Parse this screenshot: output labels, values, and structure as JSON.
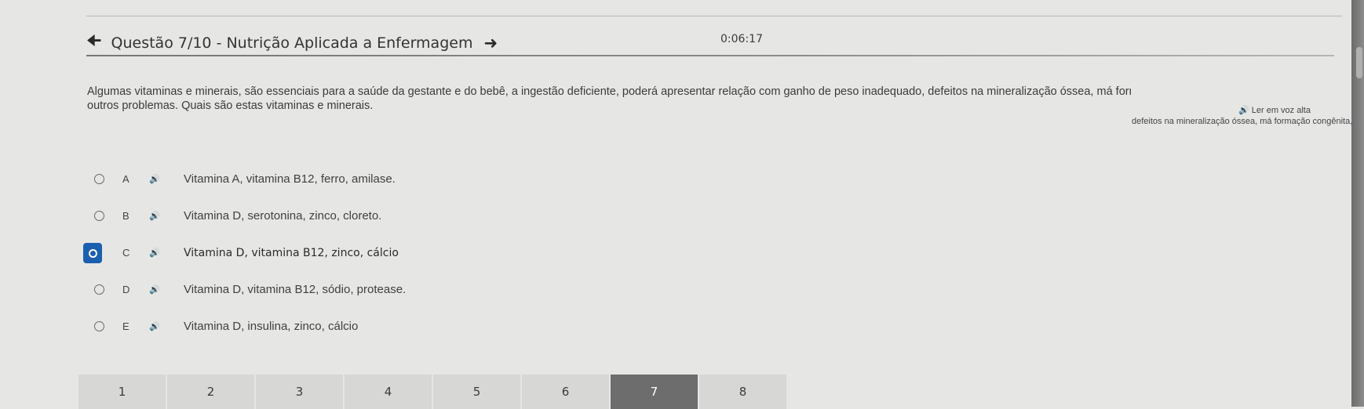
{
  "header": {
    "back_icon": "arrow-left-icon",
    "title": "Questão 7/10 - Nutrição Aplicada a Enfermagem",
    "next_icon": "arrow-right-icon",
    "timer": "0:06:17"
  },
  "question": {
    "text": "Algumas vitaminas e minerais, são essenciais para a saúde da gestante e do bebê, a ingestão deficiente, poderá apresentar relação com ganho de peso inadequado, defeitos na mineralização óssea, má formação congênita, entre outros problemas. Quais são estas vitaminas e minerais.",
    "visible_line1": "Algumas vitaminas e minerais, são essenciais para a saúde da gestante e do bebê, a ingestão deficiente, poderá apresentar relação com ganho de peso inadequado, defeitos na mineralização óssea, má formação congênita, entre",
    "visible_line2": "outros problemas. Quais são estas vitaminas e minerais.",
    "tail": "defeitos na mineralização óssea, má formação congênita, entre",
    "read_aloud_label": "🔊 Ler em voz alta"
  },
  "options": [
    {
      "letter": "A",
      "text": "Vitamina A, vitamina B12, ferro, amilase.",
      "selected": false
    },
    {
      "letter": "B",
      "text": "Vitamina D, serotonina, zinco, cloreto.",
      "selected": false
    },
    {
      "letter": "C",
      "text": "Vitamina D, vitamina B12, zinco, cálcio",
      "selected": true
    },
    {
      "letter": "D",
      "text": "Vitamina D, vitamina B12, sódio, protease.",
      "selected": false
    },
    {
      "letter": "E",
      "text": "Vitamina D, insulina, zinco, cálcio",
      "selected": false
    }
  ],
  "speaker_glyph": "🔊",
  "pager": {
    "pages": [
      "1",
      "2",
      "3",
      "4",
      "5",
      "6",
      "7",
      "8"
    ],
    "active": "7"
  },
  "colors": {
    "background": "#e6e7e5",
    "selected_radio": "#1b5fb0",
    "active_page": "#6d6d6d",
    "page": "#d7d8d6"
  }
}
